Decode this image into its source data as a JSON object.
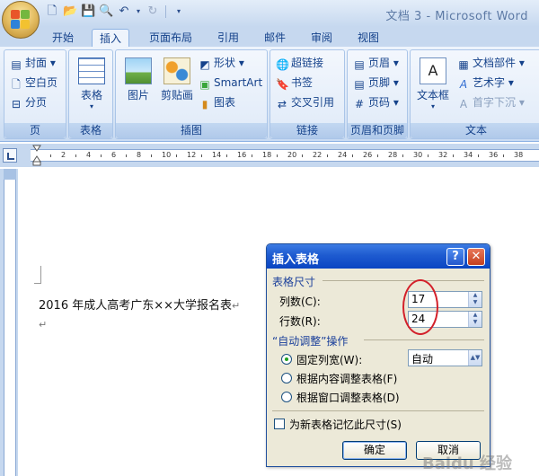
{
  "window": {
    "title": "文档 3 - Microsoft Word"
  },
  "quick_access": [
    "new-icon",
    "open-icon",
    "save-icon",
    "print-preview-icon",
    "undo-icon",
    "redo-icon",
    "customize-icon"
  ],
  "tabs": [
    {
      "label": "开始",
      "active": false
    },
    {
      "label": "插入",
      "active": true
    },
    {
      "label": "页面布局",
      "active": false
    },
    {
      "label": "引用",
      "active": false
    },
    {
      "label": "邮件",
      "active": false
    },
    {
      "label": "审阅",
      "active": false
    },
    {
      "label": "视图",
      "active": false
    }
  ],
  "ribbon": {
    "pages": {
      "label": "页",
      "items": [
        "封面",
        "空白页",
        "分页"
      ]
    },
    "tables": {
      "label": "表格",
      "button": "表格"
    },
    "illustrations": {
      "label": "插图",
      "picture": "图片",
      "clipart": "剪贴画",
      "shapes": "形状",
      "smartart": "SmartArt",
      "chart": "图表"
    },
    "links": {
      "label": "链接",
      "items": [
        "超链接",
        "书签",
        "交叉引用"
      ]
    },
    "header_footer": {
      "label": "页眉和页脚",
      "items": [
        "页眉",
        "页脚",
        "页码"
      ]
    },
    "text": {
      "label": "文本",
      "textbox": "文本框",
      "items": [
        "文档部件",
        "艺术字",
        "首字下沉"
      ]
    }
  },
  "ruler_numbers": [
    "2",
    "4",
    "6",
    "8",
    "10",
    "12",
    "14",
    "16",
    "18",
    "20",
    "22",
    "24",
    "26",
    "28",
    "30",
    "32",
    "34",
    "36",
    "38"
  ],
  "document": {
    "text": "2016 年成人高考广东××大学报名表"
  },
  "dialog": {
    "title": "插入表格",
    "help": "?",
    "close": "✕",
    "table_size_title": "表格尺寸",
    "columns_label": "列数(C):",
    "columns_value": "17",
    "rows_label": "行数(R):",
    "rows_value": "24",
    "autofit_title": "“自动调整”操作",
    "fixed_width_label": "固定列宽(W):",
    "fixed_width_value": "自动",
    "fit_content_label": "根据内容调整表格(F)",
    "fit_window_label": "根据窗口调整表格(D)",
    "remember_label": "为新表格记忆此尺寸(S)",
    "ok_label": "确定",
    "cancel_label": "取消",
    "selected_option": "fixed_width"
  },
  "watermark": "Baidu 经验",
  "colors": {
    "accent": "#15428b",
    "dialog_title": "#1e5bd0",
    "annotation": "#d3202a"
  }
}
